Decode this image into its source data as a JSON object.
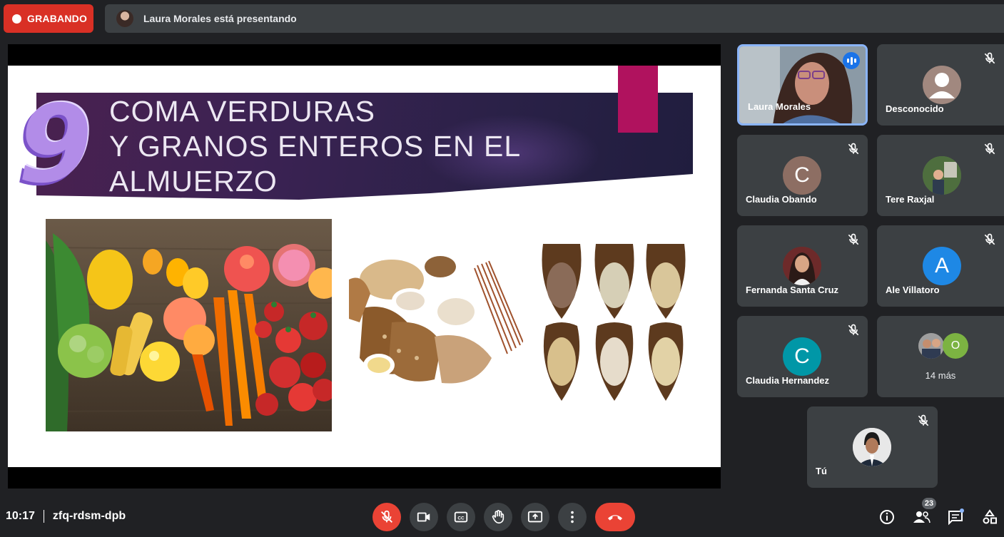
{
  "top_bar": {
    "recording_label": "GRABANDO",
    "presenting_text": "Laura Morales está presentando"
  },
  "slide": {
    "number": "9",
    "title_lines": [
      "COMA VERDURAS",
      "Y GRANOS ENTEROS EN EL",
      "ALMUERZO"
    ]
  },
  "participants": [
    {
      "name": "Laura Morales",
      "state": "speaking"
    },
    {
      "name": "Desconocido",
      "state": "muted"
    },
    {
      "name": "Claudia Obando",
      "initial": "C",
      "color": "#8d6e63",
      "state": "muted"
    },
    {
      "name": "Tere Raxjal",
      "state": "muted"
    },
    {
      "name": "Fernanda Santa Cruz",
      "state": "muted"
    },
    {
      "name": "Ale Villatoro",
      "initial": "A",
      "color": "#1e88e5",
      "state": "muted"
    },
    {
      "name": "Claudia Hernandez",
      "initial": "C",
      "color": "#0097a7",
      "state": "muted"
    },
    {
      "name": "14 más",
      "initial": "O",
      "color": "#7cb342"
    },
    {
      "name": "Tú",
      "state": "muted"
    }
  ],
  "bottom_bar": {
    "time": "10:17",
    "meeting_code": "zfq-rdsm-dpb",
    "participant_count": "23"
  },
  "colors": {
    "record_red": "#d93025",
    "end_call_red": "#ea4335",
    "active_border": "#8ab4f8",
    "tile_bg": "#3c4043"
  }
}
